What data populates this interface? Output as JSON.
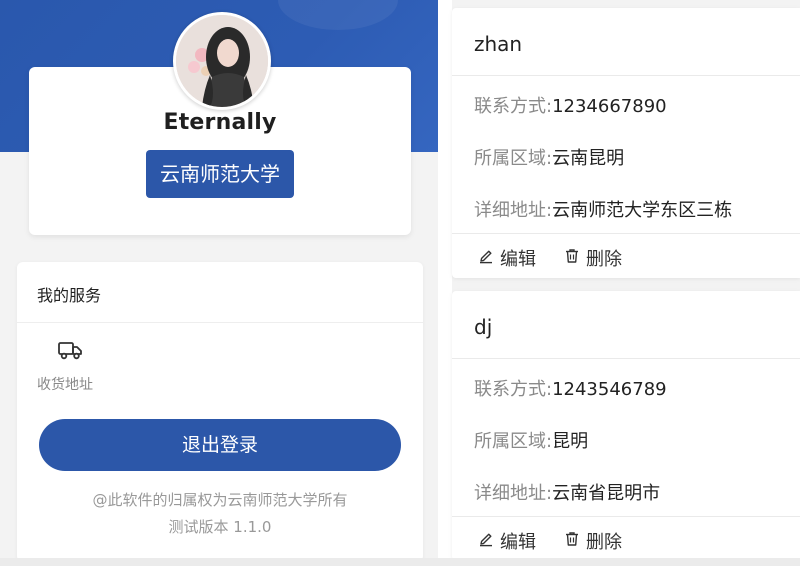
{
  "profile": {
    "username": "Eternally",
    "school": "云南师范大学"
  },
  "services": {
    "title": "我的服务",
    "items": [
      {
        "label": "收货地址",
        "icon": "truck-icon"
      }
    ]
  },
  "logout_label": "退出登录",
  "footer": {
    "copyright": "@此软件的归属权为云南师范大学所有",
    "version": "测试版本 1.1.0"
  },
  "addresses": [
    {
      "name": "zhan",
      "phone_label": "联系方式:",
      "phone": "1234667890",
      "region_label": "所属区域:",
      "region": "云南昆明",
      "detail_label": "详细地址:",
      "detail": "云南师范大学东区三栋",
      "edit_label": "编辑",
      "delete_label": "删除"
    },
    {
      "name": "dj",
      "phone_label": "联系方式:",
      "phone": "1243546789",
      "region_label": "所属区域:",
      "region": "昆明",
      "detail_label": "详细地址:",
      "detail": "云南省昆明市",
      "edit_label": "编辑",
      "delete_label": "删除"
    }
  ],
  "colors": {
    "brand_blue": "#2c57a9",
    "muted_text": "#8a8a8a"
  }
}
